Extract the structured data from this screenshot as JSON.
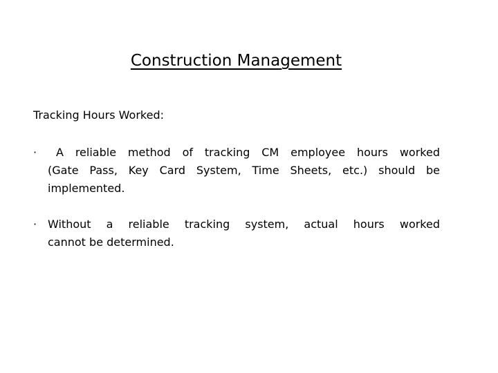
{
  "slide": {
    "background_color": "#ffffff",
    "text_color": "#000000",
    "title": "Construction Management",
    "subheading": "Tracking Hours Worked:",
    "bullet_marker": "·",
    "bullets": [
      {
        "marker": "·",
        "text": "A reliable method of tracking CM employee hours worked (Gate Pass, Key Card System, Time Sheets, etc.) should be implemented.",
        "lines": [
          "A reliable method of tracking CM employee hours worked",
          "(Gate Pass, Key Card System, Time Sheets, etc.) should be",
          "implemented."
        ]
      },
      {
        "marker": "·",
        "text": "Without a reliable tracking system, actual hours worked cannot be determined.",
        "lines": [
          "Without a reliable tracking system, actual hours worked",
          "cannot be determined."
        ]
      }
    ]
  }
}
